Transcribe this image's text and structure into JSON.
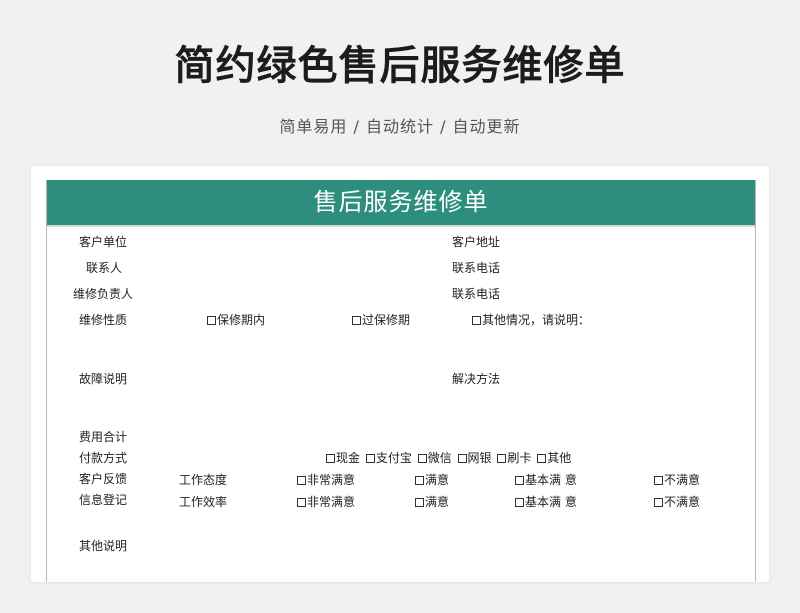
{
  "header": {
    "title": "简约绿色售后服务维修单",
    "subtitle": "简单易用 / 自动统计 / 自动更新"
  },
  "form": {
    "banner": "售后服务维修单",
    "customer_unit": "客户单位",
    "customer_address": "客户地址",
    "contact_person": "联系人",
    "contact_phone_1": "联系电话",
    "repair_person": "维修负责人",
    "contact_phone_2": "联系电话",
    "repair_nature": "维修性质",
    "nature_options": [
      "保修期内",
      "过保修期",
      "其他情况，请说明："
    ],
    "fault_desc": "故障说明",
    "solution": "解决方法",
    "fee_total": "费用合计",
    "payment_method": "付款方式",
    "payment_options": [
      "现金",
      "支付宝",
      "微信",
      "网银",
      "刷卡",
      "其他"
    ],
    "feedback": "客户反馈",
    "info_register": "信息登记",
    "work_attitude": "工作态度",
    "work_efficiency": "工作效率",
    "rating_options": [
      "非常满意",
      "满意",
      "基本满 意",
      "不满意"
    ],
    "other_desc": "其他说明"
  }
}
